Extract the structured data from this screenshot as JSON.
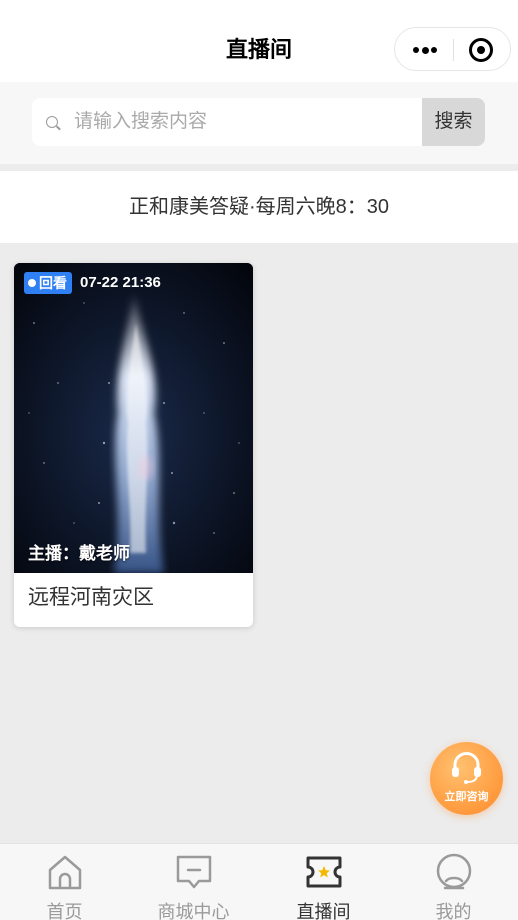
{
  "header": {
    "title": "直播间"
  },
  "search": {
    "placeholder": "请输入搜索内容",
    "button_label": "搜索"
  },
  "notice": {
    "text": "正和康美答疑·每周六晚8：30"
  },
  "cards": [
    {
      "badge": "回看",
      "time": "07-22 21:36",
      "host": "主播：戴老师",
      "title": "远程河南灾区"
    }
  ],
  "consult": {
    "label": "立即咨询"
  },
  "tabbar": {
    "items": [
      {
        "label": "首页",
        "icon": "home-icon",
        "active": false
      },
      {
        "label": "商城中心",
        "icon": "message-icon",
        "active": false
      },
      {
        "label": "直播间",
        "icon": "ticket-icon",
        "active": true
      },
      {
        "label": "我的",
        "icon": "user-icon",
        "active": false
      }
    ]
  },
  "colors": {
    "badge": "#2f7ff5",
    "consult": "#ff9a3d",
    "active_tab": "#333333",
    "inactive_tab": "#9a9a9a",
    "live_icon_star": "#f5b800"
  }
}
